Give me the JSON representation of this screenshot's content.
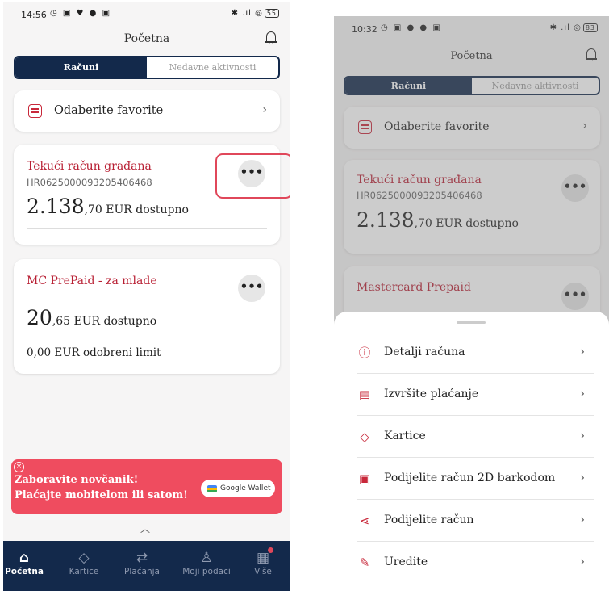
{
  "left_screen": {
    "status": {
      "time": "14:56",
      "icons": "◷ ▣ ♥ ● ▣",
      "right": "✱ .ıl ◎",
      "battery": "55"
    },
    "header": {
      "title": "Početna"
    },
    "tabs": {
      "active": "Računi",
      "inactive": "Nedavne aktivnosti"
    },
    "favorites": {
      "label": "Odaberite favorite",
      "chevron": "›"
    },
    "account1": {
      "title": "Tekući račun građana",
      "iban": "HR0625000093205406468",
      "balance_big": "2.138",
      "balance_small": ",70 EUR dostupno",
      "more": "•••"
    },
    "account2": {
      "title": "MC PrePaid - za mlade",
      "balance_big": "20",
      "balance_small": ",65 EUR dostupno",
      "limit": "0,00 EUR odobreni limit",
      "more": "•••"
    },
    "banner": {
      "close": "×",
      "line1": "Zaboravite novčanik!",
      "line2": "Plaćajte mobitelom ili satom!",
      "wallet": "Google Wallet"
    },
    "caret": "︿",
    "nav": [
      {
        "label": "Početna",
        "icon": "⌂"
      },
      {
        "label": "Kartice",
        "icon": "◇"
      },
      {
        "label": "Plaćanja",
        "icon": "⇄"
      },
      {
        "label": "Moji podaci",
        "icon": "♙"
      },
      {
        "label": "Više",
        "icon": "▦"
      }
    ]
  },
  "right_screen": {
    "status": {
      "time": "10:32",
      "icons": "◷ ▣ ● ● ▣",
      "right": "✱ .ıl ◎",
      "battery": "83"
    },
    "header": {
      "title": "Početna"
    },
    "tabs": {
      "active": "Računi",
      "inactive": "Nedavne aktivnosti"
    },
    "favorites": {
      "label": "Odaberite favorite",
      "chevron": "›"
    },
    "account1": {
      "title": "Tekući račun građana",
      "iban": "HR0625000093205406468",
      "balance_big": "2.138",
      "balance_small": ",70 EUR dostupno",
      "more": "•••"
    },
    "account2": {
      "title": "Mastercard Prepaid",
      "more": "•••"
    },
    "menu": [
      {
        "label": "Detalji računa",
        "icon": "ⓘ",
        "chevron": "›"
      },
      {
        "label": "Izvršite plaćanje",
        "icon": "▤",
        "chevron": "›"
      },
      {
        "label": "Kartice",
        "icon": "◇",
        "chevron": "›"
      },
      {
        "label": "Podijelite račun 2D barkodom",
        "icon": "▣",
        "chevron": "›"
      },
      {
        "label": "Podijelite račun",
        "icon": "⋖",
        "chevron": "›"
      },
      {
        "label": "Uredite",
        "icon": "✎",
        "chevron": "›"
      }
    ]
  },
  "colors": {
    "brand_navy": "#13294b",
    "accent_red": "#c8283a",
    "banner_red": "#ef4c5f",
    "highlight": "#e0475a"
  }
}
